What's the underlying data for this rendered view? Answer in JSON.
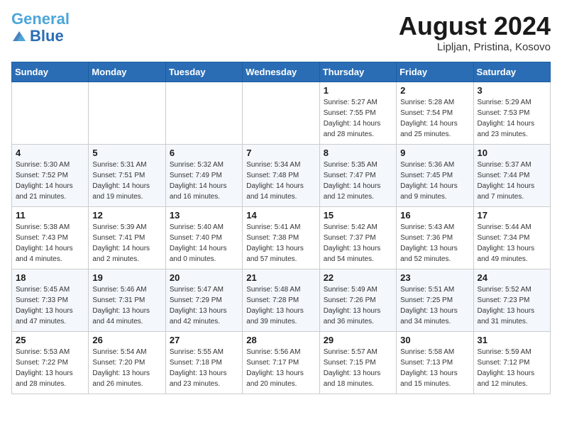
{
  "header": {
    "logo_line1": "General",
    "logo_line2": "Blue",
    "month_year": "August 2024",
    "location": "Lipljan, Pristina, Kosovo"
  },
  "days_of_week": [
    "Sunday",
    "Monday",
    "Tuesday",
    "Wednesday",
    "Thursday",
    "Friday",
    "Saturday"
  ],
  "weeks": [
    [
      {
        "day": "",
        "info": ""
      },
      {
        "day": "",
        "info": ""
      },
      {
        "day": "",
        "info": ""
      },
      {
        "day": "",
        "info": ""
      },
      {
        "day": "1",
        "info": "Sunrise: 5:27 AM\nSunset: 7:55 PM\nDaylight: 14 hours\nand 28 minutes."
      },
      {
        "day": "2",
        "info": "Sunrise: 5:28 AM\nSunset: 7:54 PM\nDaylight: 14 hours\nand 25 minutes."
      },
      {
        "day": "3",
        "info": "Sunrise: 5:29 AM\nSunset: 7:53 PM\nDaylight: 14 hours\nand 23 minutes."
      }
    ],
    [
      {
        "day": "4",
        "info": "Sunrise: 5:30 AM\nSunset: 7:52 PM\nDaylight: 14 hours\nand 21 minutes."
      },
      {
        "day": "5",
        "info": "Sunrise: 5:31 AM\nSunset: 7:51 PM\nDaylight: 14 hours\nand 19 minutes."
      },
      {
        "day": "6",
        "info": "Sunrise: 5:32 AM\nSunset: 7:49 PM\nDaylight: 14 hours\nand 16 minutes."
      },
      {
        "day": "7",
        "info": "Sunrise: 5:34 AM\nSunset: 7:48 PM\nDaylight: 14 hours\nand 14 minutes."
      },
      {
        "day": "8",
        "info": "Sunrise: 5:35 AM\nSunset: 7:47 PM\nDaylight: 14 hours\nand 12 minutes."
      },
      {
        "day": "9",
        "info": "Sunrise: 5:36 AM\nSunset: 7:45 PM\nDaylight: 14 hours\nand 9 minutes."
      },
      {
        "day": "10",
        "info": "Sunrise: 5:37 AM\nSunset: 7:44 PM\nDaylight: 14 hours\nand 7 minutes."
      }
    ],
    [
      {
        "day": "11",
        "info": "Sunrise: 5:38 AM\nSunset: 7:43 PM\nDaylight: 14 hours\nand 4 minutes."
      },
      {
        "day": "12",
        "info": "Sunrise: 5:39 AM\nSunset: 7:41 PM\nDaylight: 14 hours\nand 2 minutes."
      },
      {
        "day": "13",
        "info": "Sunrise: 5:40 AM\nSunset: 7:40 PM\nDaylight: 14 hours\nand 0 minutes."
      },
      {
        "day": "14",
        "info": "Sunrise: 5:41 AM\nSunset: 7:38 PM\nDaylight: 13 hours\nand 57 minutes."
      },
      {
        "day": "15",
        "info": "Sunrise: 5:42 AM\nSunset: 7:37 PM\nDaylight: 13 hours\nand 54 minutes."
      },
      {
        "day": "16",
        "info": "Sunrise: 5:43 AM\nSunset: 7:36 PM\nDaylight: 13 hours\nand 52 minutes."
      },
      {
        "day": "17",
        "info": "Sunrise: 5:44 AM\nSunset: 7:34 PM\nDaylight: 13 hours\nand 49 minutes."
      }
    ],
    [
      {
        "day": "18",
        "info": "Sunrise: 5:45 AM\nSunset: 7:33 PM\nDaylight: 13 hours\nand 47 minutes."
      },
      {
        "day": "19",
        "info": "Sunrise: 5:46 AM\nSunset: 7:31 PM\nDaylight: 13 hours\nand 44 minutes."
      },
      {
        "day": "20",
        "info": "Sunrise: 5:47 AM\nSunset: 7:29 PM\nDaylight: 13 hours\nand 42 minutes."
      },
      {
        "day": "21",
        "info": "Sunrise: 5:48 AM\nSunset: 7:28 PM\nDaylight: 13 hours\nand 39 minutes."
      },
      {
        "day": "22",
        "info": "Sunrise: 5:49 AM\nSunset: 7:26 PM\nDaylight: 13 hours\nand 36 minutes."
      },
      {
        "day": "23",
        "info": "Sunrise: 5:51 AM\nSunset: 7:25 PM\nDaylight: 13 hours\nand 34 minutes."
      },
      {
        "day": "24",
        "info": "Sunrise: 5:52 AM\nSunset: 7:23 PM\nDaylight: 13 hours\nand 31 minutes."
      }
    ],
    [
      {
        "day": "25",
        "info": "Sunrise: 5:53 AM\nSunset: 7:22 PM\nDaylight: 13 hours\nand 28 minutes."
      },
      {
        "day": "26",
        "info": "Sunrise: 5:54 AM\nSunset: 7:20 PM\nDaylight: 13 hours\nand 26 minutes."
      },
      {
        "day": "27",
        "info": "Sunrise: 5:55 AM\nSunset: 7:18 PM\nDaylight: 13 hours\nand 23 minutes."
      },
      {
        "day": "28",
        "info": "Sunrise: 5:56 AM\nSunset: 7:17 PM\nDaylight: 13 hours\nand 20 minutes."
      },
      {
        "day": "29",
        "info": "Sunrise: 5:57 AM\nSunset: 7:15 PM\nDaylight: 13 hours\nand 18 minutes."
      },
      {
        "day": "30",
        "info": "Sunrise: 5:58 AM\nSunset: 7:13 PM\nDaylight: 13 hours\nand 15 minutes."
      },
      {
        "day": "31",
        "info": "Sunrise: 5:59 AM\nSunset: 7:12 PM\nDaylight: 13 hours\nand 12 minutes."
      }
    ]
  ]
}
